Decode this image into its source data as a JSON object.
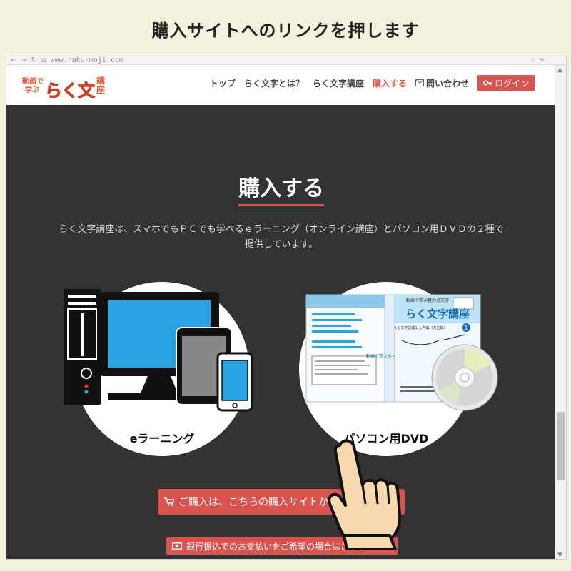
{
  "caption": "購入サイトへのリンクを押します",
  "browser": {
    "url": "www.raku-moji.com",
    "menu_icon": "hamburger-menu-icon"
  },
  "logo": {
    "line1": "動画で",
    "line2": "学ぶ",
    "main": "らく文字",
    "end": "講座"
  },
  "nav": {
    "items": [
      "トップ",
      "らく文字とは？",
      "らく文字講座",
      "購入する"
    ],
    "active_index": 3,
    "contact": "問い合わせ",
    "login": "ログイン"
  },
  "section": {
    "title": "購入する",
    "intro": "らく文字講座は、スマホでもＰＣでも学べるｅラーニング（オンライン講座）とパソコン用ＤＶＤの２種で提供しています。"
  },
  "products": [
    {
      "label": "eラーニング",
      "icon": "devices-icon"
    },
    {
      "label": "パソコン用DVD",
      "icon": "dvd-package-icon"
    }
  ],
  "dvd_package": {
    "spine": "動画で学ぶらく文字講座",
    "cover_top": "動画で学ぶ魅力の文字",
    "cover_title": "らく文字講座",
    "cover_number": "1",
    "cover_subtitle": "らく文字講座1 入門編（方言編）"
  },
  "buttons": {
    "buy": "ご購入は、こちらの購入サイトからお願いします",
    "bank": "銀行振込でのお支払いをご希望の場合はこちら"
  },
  "colors": {
    "accent": "#d9534f",
    "dark_bg": "#333333",
    "caption_bg": "#f3f0dd"
  }
}
